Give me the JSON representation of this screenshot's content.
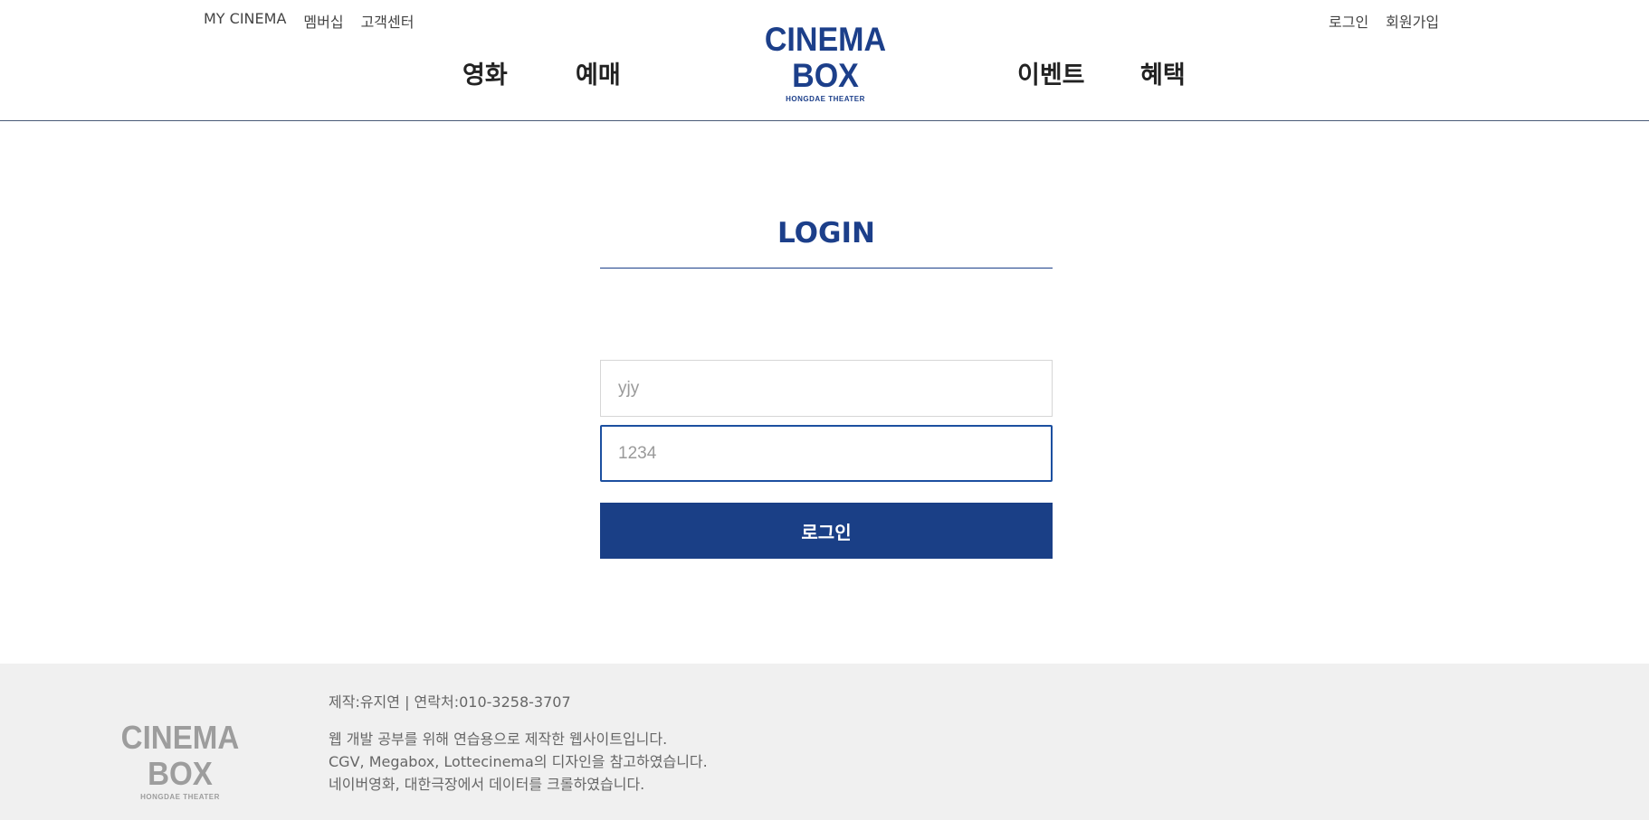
{
  "header": {
    "util_left": [
      "MY CINEMA",
      "멤버십",
      "고객센터"
    ],
    "util_right": [
      "로그인",
      "회원가입"
    ],
    "logo": {
      "main": "CINEMA BOX",
      "sub": "HONGDAE THEATER"
    },
    "nav": [
      "영화",
      "예매",
      "이벤트",
      "혜택"
    ]
  },
  "login": {
    "title": "LOGIN",
    "username_value": "yjy",
    "password_value": "1234",
    "submit_label": "로그인"
  },
  "footer": {
    "logo": {
      "main": "CINEMA BOX",
      "sub": "HONGDAE THEATER"
    },
    "contact": "제작:유지연 | 연락처:010-3258-3707",
    "lines": [
      "웹 개발 공부를 위해 연습용으로 제작한 웹사이트입니다.",
      "CGV, Megabox, Lottecinema의 디자인을 참고하였습니다.",
      "네이버영화, 대한극장에서 데이터를 크롤하였습니다."
    ]
  },
  "colors": {
    "brand": "#1c3f8a",
    "button": "#1a3f86",
    "footer_bg": "#f0f0f0"
  }
}
